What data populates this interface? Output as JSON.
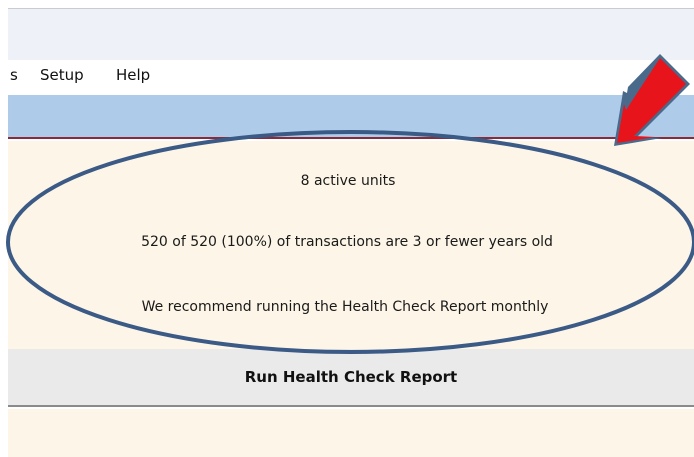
{
  "menubar": {
    "items": [
      "s",
      "Setup",
      "Help"
    ]
  },
  "health_panel": {
    "active_units": "8 active units",
    "transactions_age": "520 of 520 (100%) of transactions are 3 or fewer years old",
    "recommendation": "We recommend running the Health Check Report monthly"
  },
  "actions": {
    "run_health_check_label": "Run Health Check Report"
  },
  "annotation_colors": {
    "ellipse_stroke": "#3b5b86",
    "arrow_fill": "#e8141b",
    "arrow_outline": "#4a6a8c"
  }
}
